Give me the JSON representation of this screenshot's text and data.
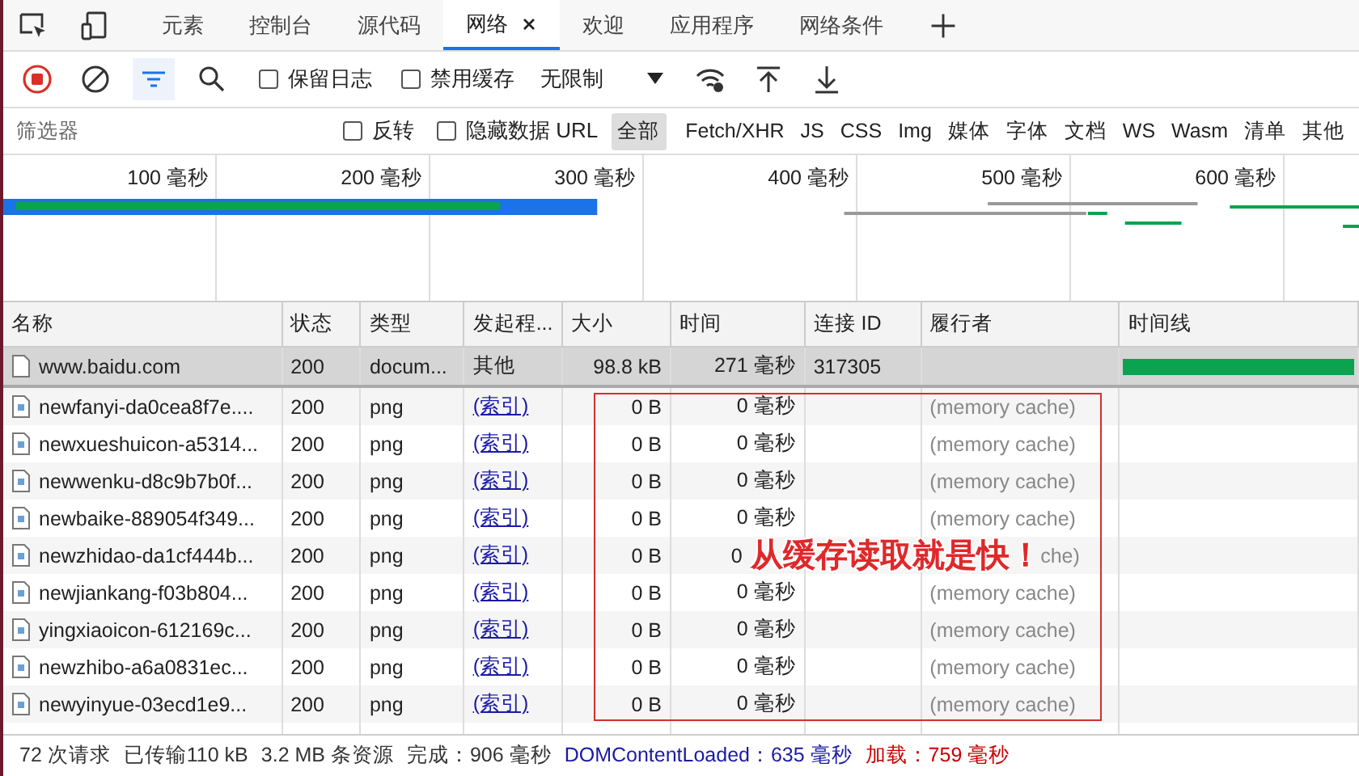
{
  "tabs": [
    {
      "label": "元素",
      "selected": false,
      "closable": false
    },
    {
      "label": "控制台",
      "selected": false,
      "closable": false
    },
    {
      "label": "源代码",
      "selected": false,
      "closable": false
    },
    {
      "label": "网络",
      "selected": true,
      "closable": true
    },
    {
      "label": "欢迎",
      "selected": false,
      "closable": false
    },
    {
      "label": "应用程序",
      "selected": false,
      "closable": false
    },
    {
      "label": "网络条件",
      "selected": false,
      "closable": false
    }
  ],
  "toolbar": {
    "recording": true,
    "filter_active": true,
    "checkboxes": [
      {
        "label": "保留日志",
        "checked": false
      },
      {
        "label": "禁用缓存",
        "checked": false
      }
    ],
    "throttle": "无限制"
  },
  "filter_bar": {
    "placeholder": "筛选器",
    "checkboxes": [
      {
        "label": "反转",
        "checked": false
      },
      {
        "label": "隐藏数据 URL",
        "checked": false
      }
    ],
    "types": [
      {
        "label": "全部",
        "selected": true
      },
      {
        "label": "Fetch/XHR",
        "selected": false
      },
      {
        "label": "JS",
        "selected": false
      },
      {
        "label": "CSS",
        "selected": false
      },
      {
        "label": "Img",
        "selected": false
      },
      {
        "label": "媒体",
        "selected": false
      },
      {
        "label": "字体",
        "selected": false
      },
      {
        "label": "文档",
        "selected": false
      },
      {
        "label": "WS",
        "selected": false
      },
      {
        "label": "Wasm",
        "selected": false
      },
      {
        "label": "清单",
        "selected": false
      },
      {
        "label": "其他",
        "selected": false
      }
    ]
  },
  "overview": {
    "ticks": [
      "100 毫秒",
      "200 毫秒",
      "300 毫秒",
      "400 毫秒",
      "500 毫秒",
      "600 毫秒"
    ]
  },
  "table": {
    "columns": [
      "名称",
      "状态",
      "类型",
      "发起程...",
      "大小",
      "时间",
      "连接 ID",
      "履行者",
      "时间线"
    ],
    "rows": [
      {
        "kind": "document",
        "selected": true,
        "bar": true,
        "cells": [
          "www.baidu.com",
          "200",
          "docum...",
          "其他",
          "98.8 kB",
          "271 毫秒",
          "317305",
          ""
        ],
        "initiator_link": false
      },
      {
        "kind": "image",
        "selected": false,
        "bar": false,
        "cells": [
          "newfanyi-da0cea8f7e....",
          "200",
          "png",
          "(索引)",
          "0 B",
          "0 毫秒",
          "",
          "(memory cache)"
        ],
        "initiator_link": true
      },
      {
        "kind": "image",
        "selected": false,
        "bar": false,
        "cells": [
          "newxueshuicon-a5314...",
          "200",
          "png",
          "(索引)",
          "0 B",
          "0 毫秒",
          "",
          "(memory cache)"
        ],
        "initiator_link": true
      },
      {
        "kind": "image",
        "selected": false,
        "bar": false,
        "cells": [
          "newwenku-d8c9b7b0f...",
          "200",
          "png",
          "(索引)",
          "0 B",
          "0 毫秒",
          "",
          "(memory cache)"
        ],
        "initiator_link": true
      },
      {
        "kind": "image",
        "selected": false,
        "bar": false,
        "cells": [
          "newbaike-889054f349...",
          "200",
          "png",
          "(索引)",
          "0 B",
          "0 毫秒",
          "",
          "(memory cache)"
        ],
        "initiator_link": true
      },
      {
        "kind": "image",
        "selected": false,
        "bar": false,
        "cells": [
          "newzhidao-da1cf444b...",
          "200",
          "png",
          "(索引)",
          "0 B",
          "0",
          "",
          "che)"
        ],
        "initiator_link": true,
        "occluded": true
      },
      {
        "kind": "image",
        "selected": false,
        "bar": false,
        "cells": [
          "newjiankang-f03b804...",
          "200",
          "png",
          "(索引)",
          "0 B",
          "0 毫秒",
          "",
          "(memory cache)"
        ],
        "initiator_link": true
      },
      {
        "kind": "image",
        "selected": false,
        "bar": false,
        "cells": [
          "yingxiaoicon-612169c...",
          "200",
          "png",
          "(索引)",
          "0 B",
          "0 毫秒",
          "",
          "(memory cache)"
        ],
        "initiator_link": true
      },
      {
        "kind": "image",
        "selected": false,
        "bar": false,
        "cells": [
          "newzhibo-a6a0831ec...",
          "200",
          "png",
          "(索引)",
          "0 B",
          "0 毫秒",
          "",
          "(memory cache)"
        ],
        "initiator_link": true
      },
      {
        "kind": "image",
        "selected": false,
        "bar": false,
        "cells": [
          "newyinyue-03ecd1e9...",
          "200",
          "png",
          "(索引)",
          "0 B",
          "0 毫秒",
          "",
          "(memory cache)"
        ],
        "initiator_link": true
      }
    ]
  },
  "annotation": {
    "text": "从缓存读取就是快！"
  },
  "status_bar": [
    {
      "text": "72 次请求",
      "kind": "plain"
    },
    {
      "text": "已传输110 kB",
      "kind": "plain"
    },
    {
      "text": "3.2 MB 条资源",
      "kind": "plain"
    },
    {
      "text": "完成：906 毫秒",
      "kind": "plain"
    },
    {
      "text": "DOMContentLoaded：635 毫秒",
      "kind": "dom"
    },
    {
      "text": "加载：759 毫秒",
      "kind": "load"
    }
  ]
}
